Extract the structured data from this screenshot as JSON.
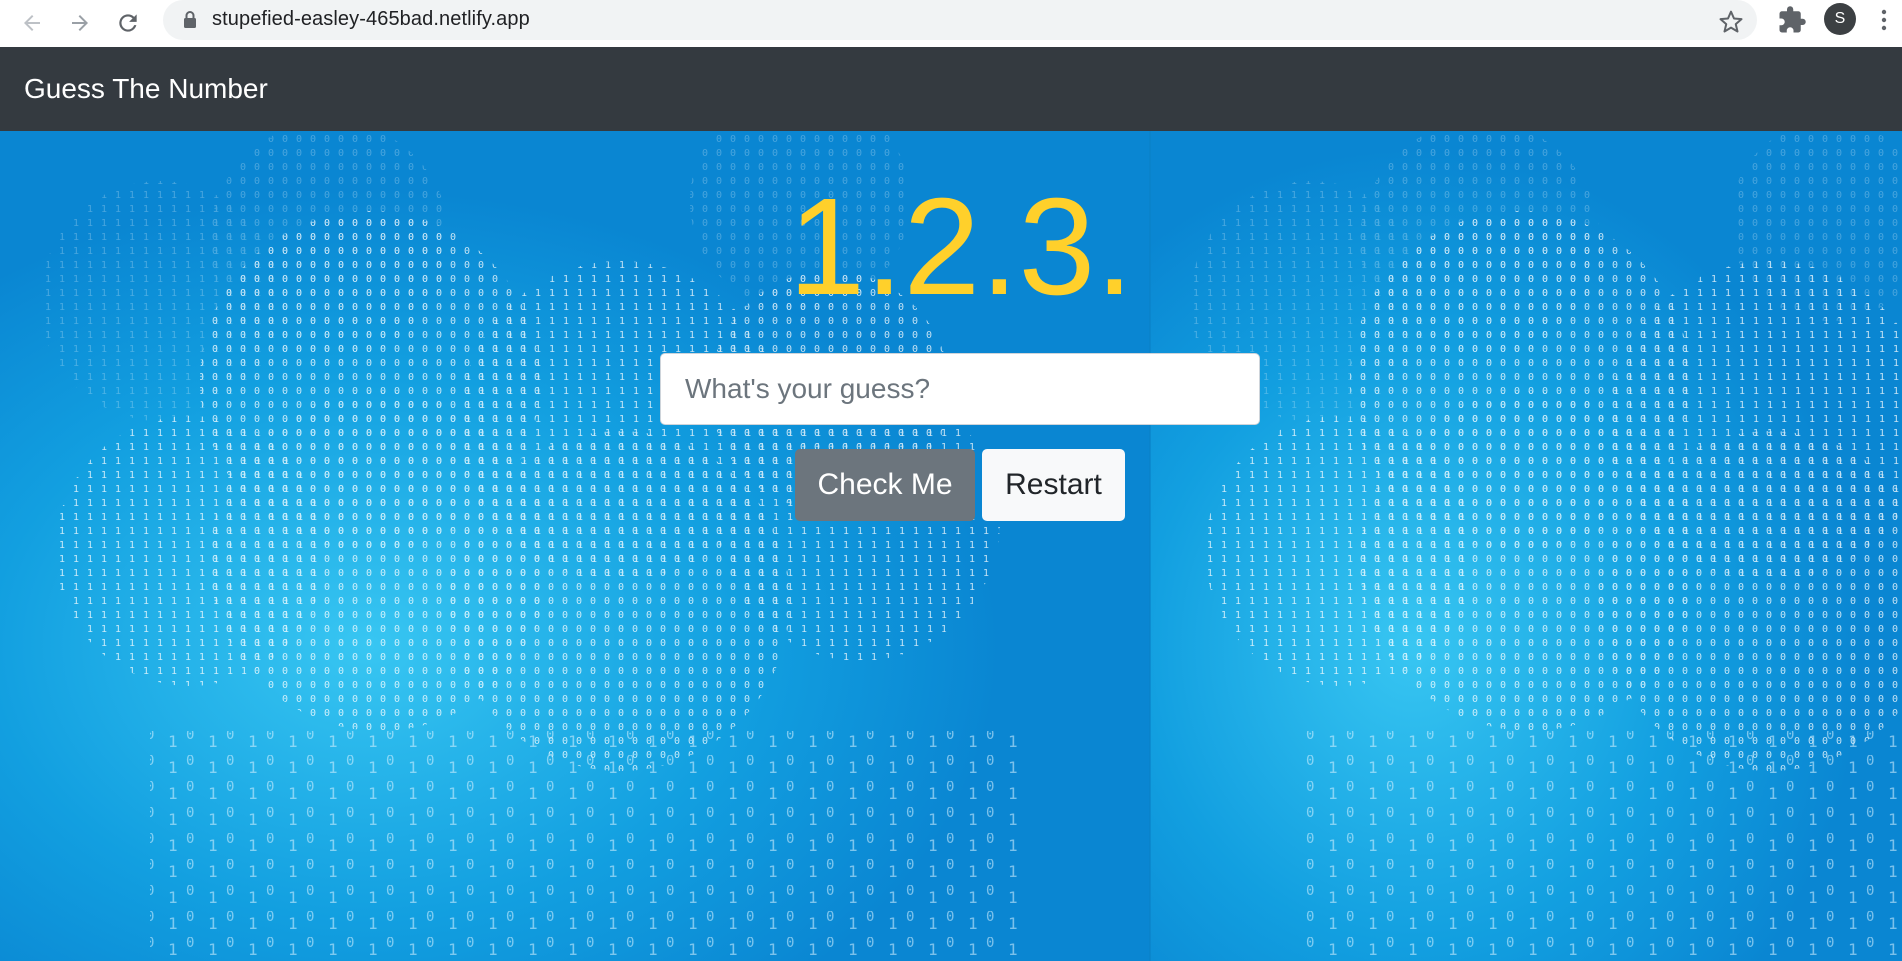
{
  "browser": {
    "url": "stupefied-easley-465bad.netlify.app",
    "profile_initial": "S",
    "icons": [
      "back-arrow-icon",
      "forward-arrow-icon",
      "reload-icon",
      "lock-icon",
      "star-icon",
      "extensions-puzzle-icon",
      "menu-dots-icon"
    ]
  },
  "navbar": {
    "brand": "Guess The Number"
  },
  "game": {
    "number_display": "1.2.3.",
    "input_placeholder": "What's your guess?",
    "input_value": "",
    "check_label": "Check Me",
    "restart_label": "Restart"
  },
  "colors": {
    "navbar_bg": "#343a40",
    "number_color": "#ffd02b",
    "check_button_bg": "#6c757d",
    "restart_button_bg": "#f8f9fa",
    "background_blue": "#0a8fd8"
  }
}
